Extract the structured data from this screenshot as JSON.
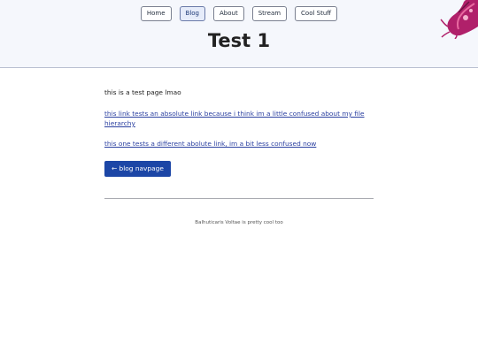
{
  "nav": {
    "items": [
      {
        "label": "Home",
        "active": false
      },
      {
        "label": "Blog",
        "active": true
      },
      {
        "label": "About",
        "active": false
      },
      {
        "label": "Stream",
        "active": false
      },
      {
        "label": "Cool Stuff",
        "active": false
      }
    ]
  },
  "page": {
    "title": "Test 1"
  },
  "content": {
    "intro": "this is a test page lmao",
    "link1": "this link tests an absolute link because i think im a little confused about my file hierarchy",
    "link2": "this one tests a different abolute link, im a bit less confused now",
    "back_button": "← blog navpage"
  },
  "footer": {
    "text": "Balhuticaris Voltae is pretty cool too"
  },
  "colors": {
    "header_bg": "#f5f7fc",
    "link": "#2a3fa0",
    "button_bg": "#1c46a6",
    "corner_art": "#b0206a"
  }
}
